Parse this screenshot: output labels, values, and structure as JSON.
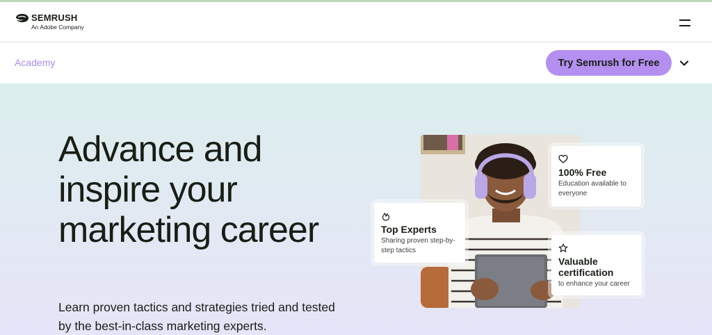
{
  "header": {
    "logo_word": "SEMRUSH",
    "logo_sub": "An Adobe Company",
    "menu_icon": "hamburger-menu-icon"
  },
  "subnav": {
    "title": "Academy",
    "cta_label": "Try Semrush for Free",
    "chevron_icon": "chevron-down-icon"
  },
  "hero": {
    "title": "Advance and inspire your marketing career",
    "description": "Learn proven tactics and strategies tried and tested by the best-in-class marketing experts."
  },
  "cards": {
    "free": {
      "icon": "heart-icon",
      "title": "100% Free",
      "text": "Education available to everyone"
    },
    "experts": {
      "icon": "flame-icon",
      "title": "Top Experts",
      "text": "Sharing proven step-by-step tactics"
    },
    "cert": {
      "icon": "star-icon",
      "title": "Valuable certification",
      "text": "to enhance your career"
    }
  },
  "colors": {
    "accent": "#b48ff0",
    "academy_text": "#a78be8",
    "text": "#181e15",
    "top_accent": "#b9d8b6"
  }
}
